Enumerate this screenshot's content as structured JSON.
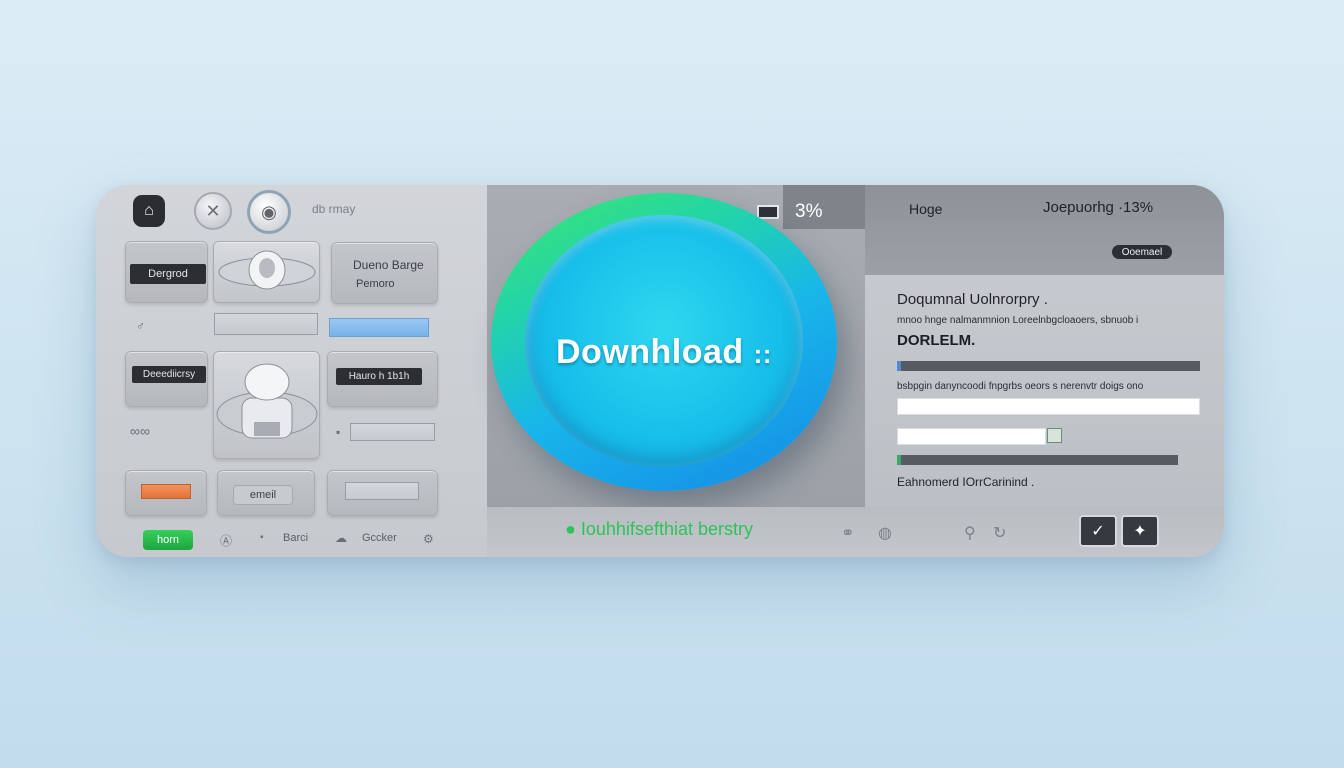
{
  "left_panel": {
    "tile_labels": {
      "tile1": "Dergrod",
      "tile3_line1": "Dueno Barge",
      "tile3_line2": "Pemoro",
      "tile4": "Deeediicrsy",
      "tile6": "Hauro h 1b1h",
      "email_button": "emeil",
      "green_button": "horn"
    },
    "top_text": "db rmay",
    "bottom_text_1": "Barci",
    "bottom_text_2": "Gccker"
  },
  "middle_panel": {
    "percent": "3%",
    "main_button_label": "Downhload",
    "main_button_suffix": "::",
    "status_text": "Iouhhifsefthiat berstry"
  },
  "right_panel": {
    "header_left": "Hoge",
    "header_right": "Joepuorhg ·13%",
    "pill": "Ooemael",
    "title": "Doqumnal Uolnrorpry .",
    "subtitle": "mnoo hnge nalmanmnion Loreelnbgcloaoers, sbnuob i",
    "bold_label": "DORLELM.",
    "description": "bsbpgin danyncoodi fnpgrbs oeors s nerenvtr doigs ono",
    "footer": "Eahnomerd IOrrCarinind ."
  },
  "colors": {
    "accent_green": "#2ec25a",
    "accent_blue": "#18b6ea",
    "panel_dark": "#2c2e33"
  }
}
